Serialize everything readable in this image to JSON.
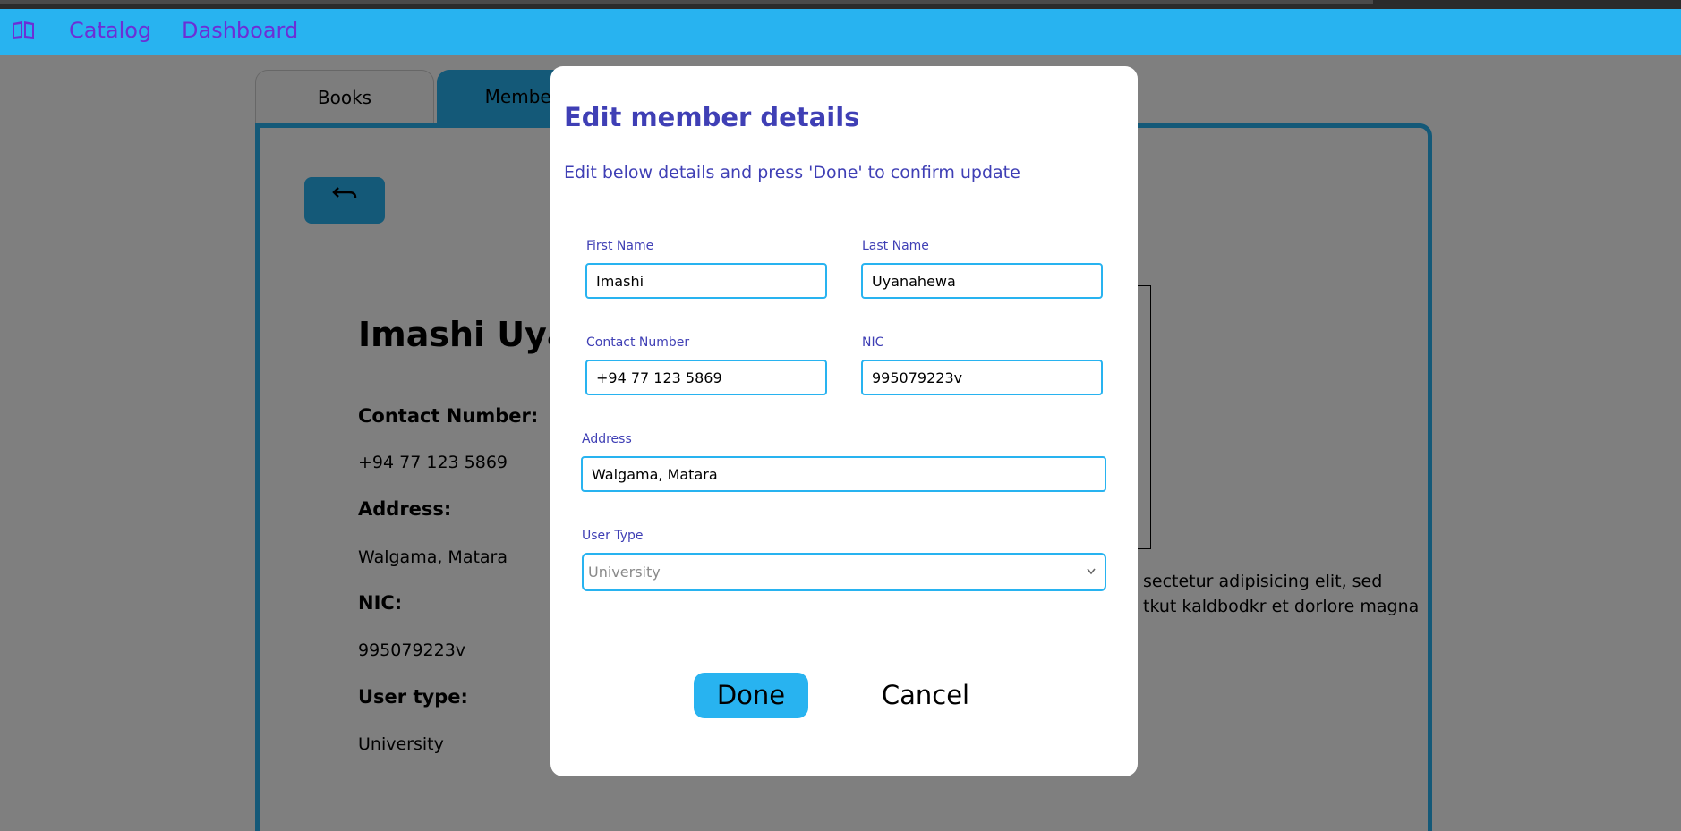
{
  "navbar": {
    "logo_icon": "book-open-icon",
    "links": [
      "Catalog",
      "Dashboard"
    ]
  },
  "tabs": [
    "Books",
    "Members"
  ],
  "back_button": {
    "icon": "back-arrow-icon",
    "glyph": "⮢"
  },
  "member": {
    "name": "Imashi Uyanahewa",
    "contact_label": "Contact Number:",
    "contact_value": "+94 77 123 5869",
    "address_label": "Address:",
    "address_value": "Walgama, Matara",
    "nic_label": "NIC:",
    "nic_value": "995079223v",
    "usertype_label": "User type:",
    "usertype_value": "University",
    "description_lines": [
      "sectetur adipisicing elit, sed",
      "tkut kaldbodkr et dorlore magna"
    ]
  },
  "modal": {
    "title": "Edit member details",
    "subtitle": "Edit below details and press 'Done' to confirm update",
    "first_name": {
      "label": "First Name",
      "value": "Imashi"
    },
    "last_name": {
      "label": "Last Name",
      "value": "Uyanahewa"
    },
    "contact": {
      "label": "Contact Number",
      "value": "+94 77 123 5869"
    },
    "nic": {
      "label": "NIC",
      "value": "995079223v"
    },
    "address": {
      "label": "Address",
      "value": "Walgama, Matara"
    },
    "user_type": {
      "label": "User Type",
      "value": "University"
    },
    "done_label": "Done",
    "cancel_label": "Cancel"
  },
  "colors": {
    "accent": "#28b3f0",
    "nav_link": "#6c2fd6",
    "modal_text": "#3f3fb5"
  }
}
